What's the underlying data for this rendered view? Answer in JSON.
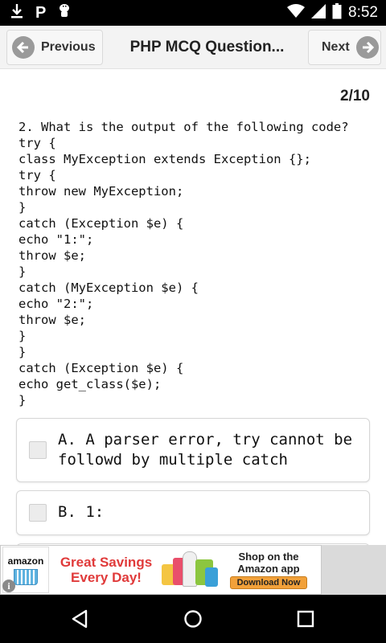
{
  "status_bar": {
    "time": "8:52",
    "notification_letter": "P"
  },
  "toolbar": {
    "previous_label": "Previous",
    "title": "PHP MCQ Question...",
    "next_label": "Next"
  },
  "question": {
    "counter": "2/10",
    "lines": [
      "2. What is the output of the following code?",
      "try {",
      "class MyException extends Exception {};",
      "try {",
      "throw new MyException;",
      "}",
      "catch (Exception $e) {",
      "echo \"1:\";",
      "throw $e;",
      "}",
      "catch (MyException $e) {",
      "echo \"2:\";",
      "throw $e;",
      "}",
      "}",
      "catch (Exception $e) {",
      "echo get_class($e);",
      "}"
    ]
  },
  "options": [
    {
      "text": "A. A parser error, try cannot be followd by multiple catch",
      "checked": false
    },
    {
      "text": "B. 1:",
      "checked": false
    }
  ],
  "ad": {
    "brand": "amazon",
    "headline": "Great Savings Every Day!",
    "cta_text": "Shop on the Amazon app",
    "button": "Download Now",
    "info_symbol": "i"
  }
}
